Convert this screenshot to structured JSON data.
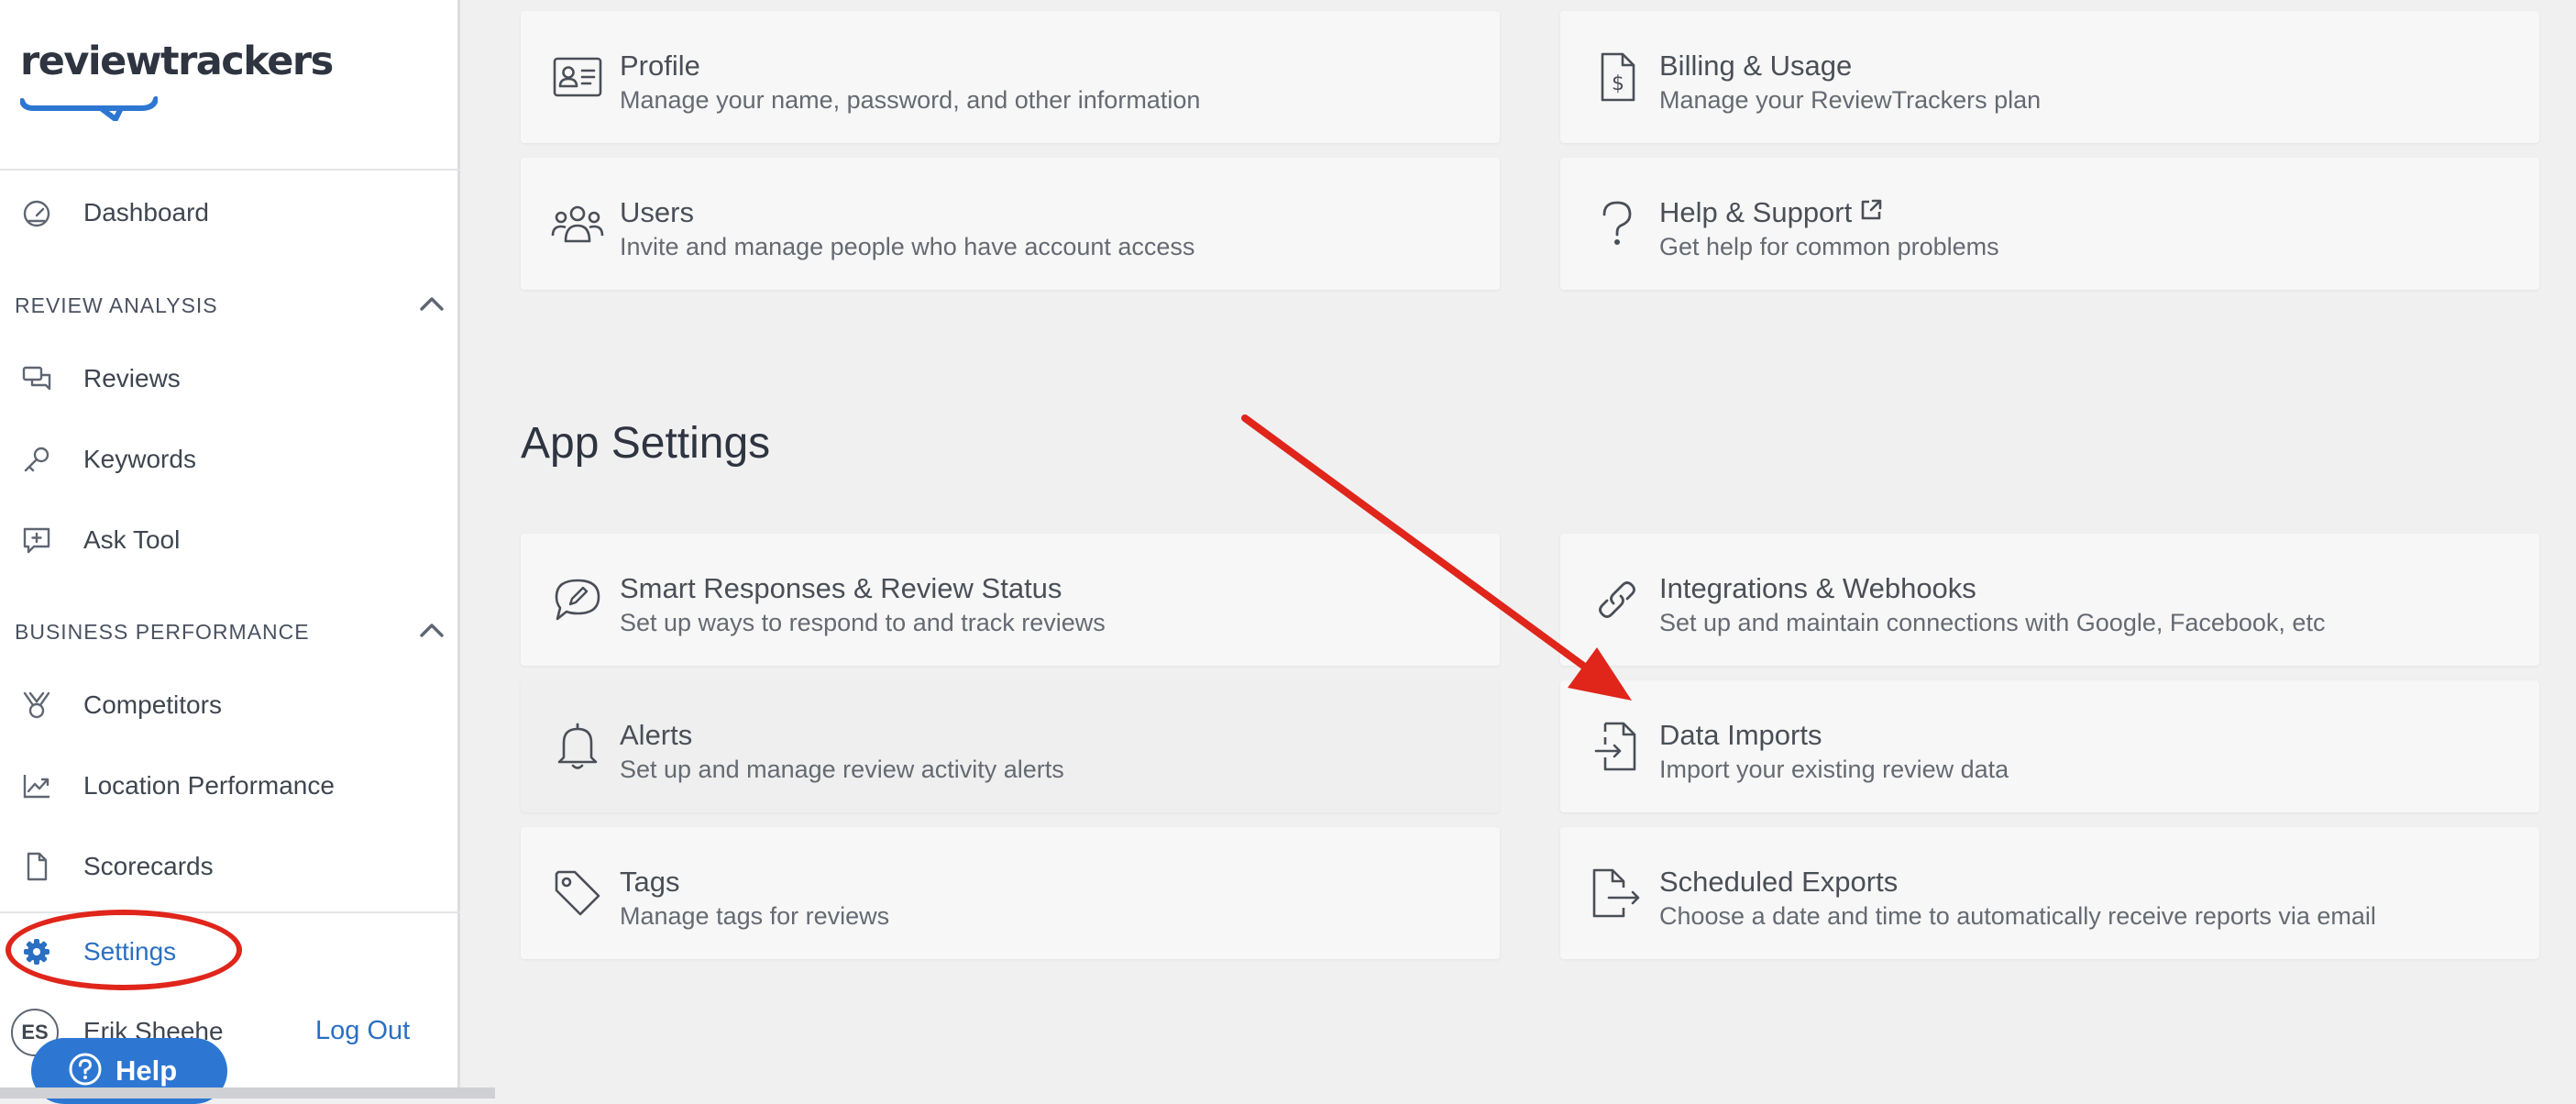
{
  "brand": {
    "logo_text": "reviewtrackers"
  },
  "sidebar": {
    "dashboard": "Dashboard",
    "sections": [
      {
        "label": "REVIEW ANALYSIS",
        "items": [
          "Reviews",
          "Keywords",
          "Ask Tool"
        ]
      },
      {
        "label": "BUSINESS PERFORMANCE",
        "items": [
          "Competitors",
          "Location Performance",
          "Scorecards"
        ]
      }
    ],
    "settings": "Settings",
    "user_initials": "ES",
    "user_name": "Erik Sheehe",
    "logout": "Log Out",
    "help": "Help"
  },
  "account_settings": {
    "cards": [
      {
        "title": "Profile",
        "desc": "Manage your name, password, and other information",
        "icon": "id-card-icon"
      },
      {
        "title": "Billing & Usage",
        "desc": "Manage your ReviewTrackers plan",
        "icon": "invoice-icon"
      },
      {
        "title": "Users",
        "desc": "Invite and manage people who have account access",
        "icon": "users-icon"
      },
      {
        "title": "Help & Support",
        "desc": "Get help for common problems",
        "icon": "question-icon"
      }
    ]
  },
  "app_settings": {
    "title": "App Settings",
    "cards": [
      {
        "title": "Smart Responses & Review Status",
        "desc": "Set up ways to respond to and track reviews",
        "icon": "chat-pencil-icon"
      },
      {
        "title": "Integrations & Webhooks",
        "desc": "Set up and maintain connections with Google, Facebook, etc",
        "icon": "link-icon"
      },
      {
        "title": "Alerts",
        "desc": "Set up and manage review activity alerts",
        "icon": "bell-icon"
      },
      {
        "title": "Data Imports",
        "desc": "Import your existing review data",
        "icon": "file-import-icon"
      },
      {
        "title": "Tags",
        "desc": "Manage tags for reviews",
        "icon": "tag-icon"
      },
      {
        "title": "Scheduled Exports",
        "desc": "Choose a date and time to automatically receive reports via email",
        "icon": "file-export-icon"
      }
    ]
  },
  "colors": {
    "accent": "#2a6fc1",
    "help_button": "#2d77d2",
    "annotation_red": "#e0251b"
  }
}
